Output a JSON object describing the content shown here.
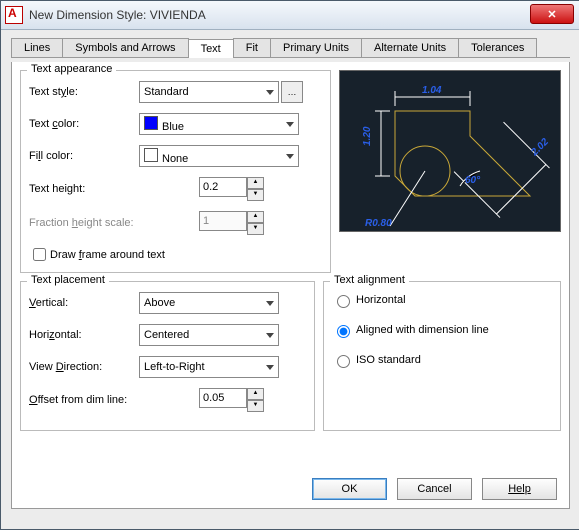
{
  "window": {
    "title": "New Dimension Style: VIVIENDA"
  },
  "tabs": [
    "Lines",
    "Symbols and Arrows",
    "Text",
    "Fit",
    "Primary Units",
    "Alternate Units",
    "Tolerances"
  ],
  "active_tab": 2,
  "appearance": {
    "group_label": "Text appearance",
    "style_label": "Text style:",
    "style_value": "Standard",
    "color_label": "Text color:",
    "color_value": "Blue",
    "fill_label": "Fill color:",
    "fill_value": "None",
    "height_label": "Text height:",
    "height_value": "0.2",
    "fraction_label": "Fraction height scale:",
    "fraction_value": "1",
    "frame_label": "Draw frame around text"
  },
  "placement": {
    "group_label": "Text placement",
    "vertical_label": "Vertical:",
    "vertical_value": "Above",
    "horizontal_label": "Horizontal:",
    "horizontal_value": "Centered",
    "viewdir_label": "View Direction:",
    "viewdir_value": "Left-to-Right",
    "offset_label": "Offset from dim line:",
    "offset_value": "0.05"
  },
  "alignment": {
    "group_label": "Text alignment",
    "horizontal": "Horizontal",
    "aligned": "Aligned with dimension line",
    "iso": "ISO standard"
  },
  "preview": {
    "d1": "1.04",
    "d2": "1.20",
    "d3": "2.02",
    "r": "R0.80",
    "ang": "60°"
  },
  "buttons": {
    "ok": "OK",
    "cancel": "Cancel",
    "help": "Help"
  }
}
